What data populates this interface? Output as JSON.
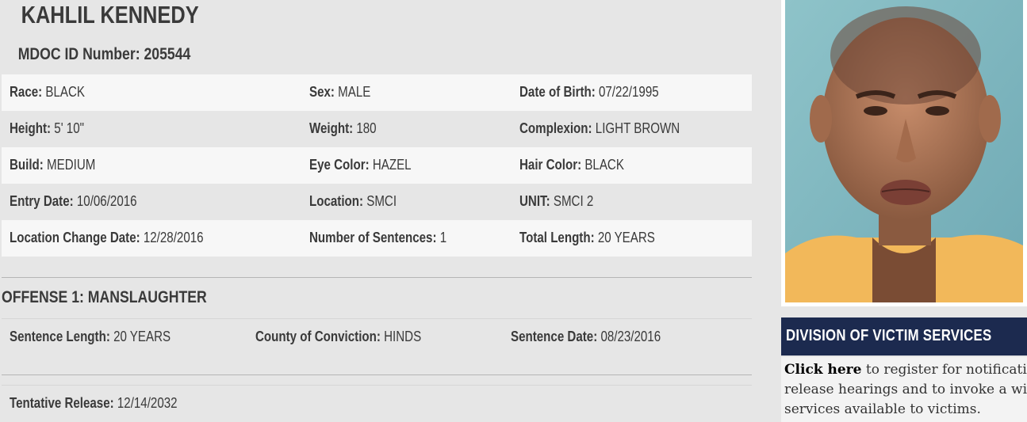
{
  "inmate": {
    "name": "KAHLIL KENNEDY",
    "id_label": "MDOC ID Number:",
    "id_value": "205544"
  },
  "details": [
    [
      {
        "label": "Race:",
        "value": "BLACK"
      },
      {
        "label": "Sex:",
        "value": "MALE"
      },
      {
        "label": "Date of Birth:",
        "value": "07/22/1995"
      }
    ],
    [
      {
        "label": "Height:",
        "value": "5' 10\""
      },
      {
        "label": "Weight:",
        "value": "180"
      },
      {
        "label": "Complexion:",
        "value": "LIGHT BROWN"
      }
    ],
    [
      {
        "label": "Build:",
        "value": "MEDIUM"
      },
      {
        "label": "Eye Color:",
        "value": "HAZEL"
      },
      {
        "label": "Hair Color:",
        "value": "BLACK"
      }
    ],
    [
      {
        "label": "Entry Date:",
        "value": "10/06/2016"
      },
      {
        "label": "Location:",
        "value": "SMCI"
      },
      {
        "label": "UNIT:",
        "value": "SMCI 2"
      }
    ],
    [
      {
        "label": "Location Change Date:",
        "value": "12/28/2016"
      },
      {
        "label": "Number of Sentences:",
        "value": "1"
      },
      {
        "label": "Total Length:",
        "value": "20 YEARS"
      }
    ]
  ],
  "offense": {
    "title": "OFFENSE 1: MANSLAUGHTER",
    "fields": [
      {
        "label": "Sentence Length:",
        "value": "20 YEARS"
      },
      {
        "label": "County of Conviction:",
        "value": "HINDS"
      },
      {
        "label": "Sentence Date:",
        "value": "08/23/2016"
      }
    ]
  },
  "release": {
    "label": "Tentative Release:",
    "value": "12/14/2032"
  },
  "victim_services": {
    "title": "DIVISION OF VICTIM SERVICES",
    "link_text": "Click here",
    "body_text": " to register for notification release hearings and to invoke a wide services available to victims."
  },
  "colors": {
    "background": "#e6e6e6",
    "row_alt": "#f7f7f7",
    "victim_header_bg": "#1c2a4f"
  }
}
